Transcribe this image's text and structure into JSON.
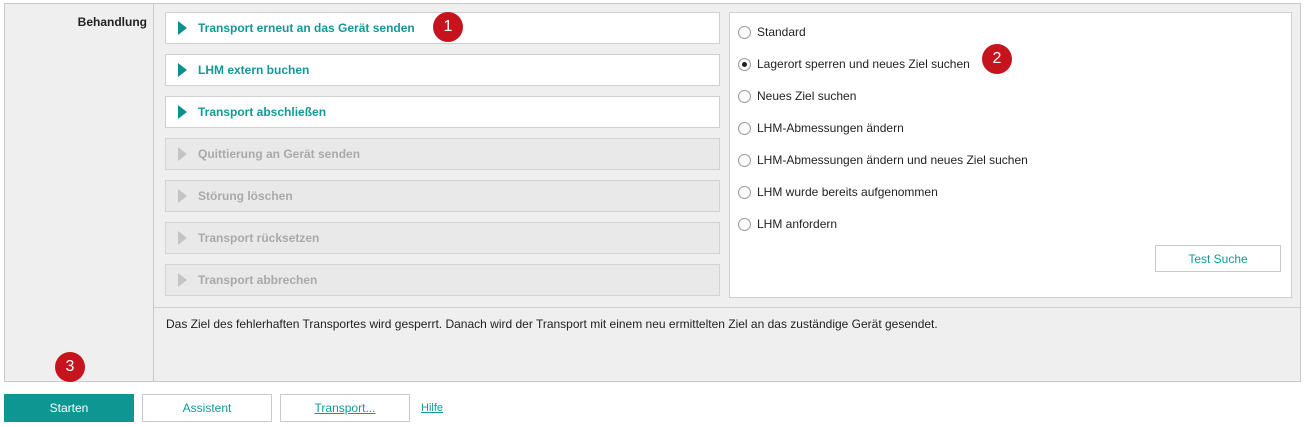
{
  "section": {
    "label": "Behandlung"
  },
  "actions": [
    {
      "label": "Transport erneut an das Gerät senden",
      "enabled": true
    },
    {
      "label": "LHM extern buchen",
      "enabled": true
    },
    {
      "label": "Transport abschließen",
      "enabled": true
    },
    {
      "label": "Quittierung an Gerät senden",
      "enabled": false
    },
    {
      "label": "Störung löschen",
      "enabled": false
    },
    {
      "label": "Transport rücksetzen",
      "enabled": false
    },
    {
      "label": "Transport abbrechen",
      "enabled": false
    }
  ],
  "options": [
    {
      "label": "Standard",
      "checked": false
    },
    {
      "label": "Lagerort sperren und neues Ziel suchen",
      "checked": true
    },
    {
      "label": "Neues Ziel suchen",
      "checked": false
    },
    {
      "label": "LHM-Abmessungen ändern",
      "checked": false
    },
    {
      "label": "LHM-Abmessungen ändern und neues Ziel suchen",
      "checked": false
    },
    {
      "label": "LHM wurde bereits aufgenommen",
      "checked": false
    },
    {
      "label": "LHM anfordern",
      "checked": false
    }
  ],
  "test_search_label": "Test Suche",
  "description": "Das Ziel des fehlerhaften Transportes wird gesperrt. Danach wird der Transport mit einem neu ermittelten Ziel an das zuständige Gerät gesendet.",
  "badges": [
    "1",
    "2",
    "3"
  ],
  "footer": {
    "start_label": "Starten",
    "assistant_label": "Assistent",
    "transport_label": "Transport...",
    "help_label": "Hilfe"
  },
  "colors": {
    "accent": "#139898",
    "primary_button": "#0e9692",
    "badge": "#c5141e",
    "disabled_text": "#a9a9a9"
  }
}
